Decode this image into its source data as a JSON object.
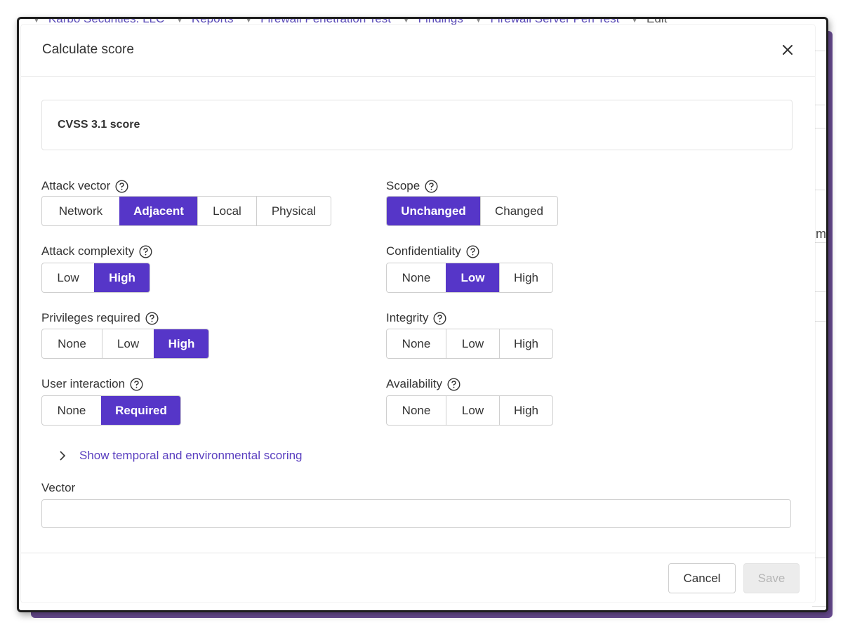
{
  "background": {
    "breadcrumb": [
      "Karbo Securities. LLC",
      "Reports",
      "Firewall Penetration Test",
      "Findings",
      "Firewall Server Pen Test",
      "Edit"
    ],
    "partial_text": "m"
  },
  "modal": {
    "title": "Calculate score",
    "close_icon": "close-icon",
    "score_label": "CVSS 3.1 score",
    "metrics": {
      "attack_vector": {
        "label": "Attack vector",
        "options": [
          "Network",
          "Adjacent",
          "Local",
          "Physical"
        ],
        "selected": "Adjacent"
      },
      "attack_complexity": {
        "label": "Attack complexity",
        "options": [
          "Low",
          "High"
        ],
        "selected": "High"
      },
      "privileges_required": {
        "label": "Privileges required",
        "options": [
          "None",
          "Low",
          "High"
        ],
        "selected": "High"
      },
      "user_interaction": {
        "label": "User interaction",
        "options": [
          "None",
          "Required"
        ],
        "selected": "Required"
      },
      "scope": {
        "label": "Scope",
        "options": [
          "Unchanged",
          "Changed"
        ],
        "selected": "Unchanged"
      },
      "confidentiality": {
        "label": "Confidentiality",
        "options": [
          "None",
          "Low",
          "High"
        ],
        "selected": "Low"
      },
      "integrity": {
        "label": "Integrity",
        "options": [
          "None",
          "Low",
          "High"
        ],
        "selected": ""
      },
      "availability": {
        "label": "Availability",
        "options": [
          "None",
          "Low",
          "High"
        ],
        "selected": ""
      }
    },
    "toggle_label": "Show temporal and environmental scoring",
    "vector": {
      "label": "Vector",
      "value": ""
    },
    "footer": {
      "cancel_label": "Cancel",
      "save_label": "Save"
    }
  },
  "colors": {
    "accent": "#5636c8",
    "link": "#5a3fc0",
    "frame_shadow": "#6a4c93"
  }
}
